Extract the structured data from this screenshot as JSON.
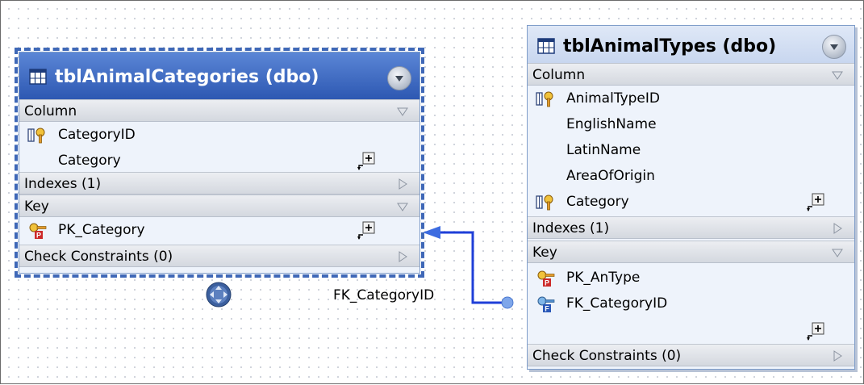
{
  "colors": {
    "selection_accent": "#3f68b7",
    "relation_line": "#1f3fd8",
    "header_selected": "#2d58b2"
  },
  "tables": [
    {
      "title": "tblAnimalCategories (dbo)",
      "icon": "table-icon",
      "selected": true,
      "column_header": "Column",
      "columns": [
        {
          "name": "CategoryID",
          "icon": "key-column-icon"
        },
        {
          "name": "Category",
          "icon": ""
        }
      ],
      "indexes_header": "Indexes (1)",
      "key_header": "Key",
      "keys": [
        {
          "name": "PK_Category",
          "icon": "primary-key-icon"
        }
      ],
      "checks_header": "Check Constraints (0)"
    },
    {
      "title": "tblAnimalTypes (dbo)",
      "icon": "table-icon",
      "selected": false,
      "column_header": "Column",
      "columns": [
        {
          "name": "AnimalTypeID",
          "icon": "key-column-icon"
        },
        {
          "name": "EnglishName",
          "icon": ""
        },
        {
          "name": "LatinName",
          "icon": ""
        },
        {
          "name": "AreaOfOrigin",
          "icon": ""
        },
        {
          "name": "Category",
          "icon": "key-column-icon"
        }
      ],
      "indexes_header": "Indexes (1)",
      "key_header": "Key",
      "keys": [
        {
          "name": "PK_AnType",
          "icon": "primary-key-icon"
        },
        {
          "name": "FK_CategoryID",
          "icon": "foreign-key-icon"
        }
      ],
      "checks_header": "Check Constraints (0)"
    }
  ],
  "relation": {
    "label": "FK_CategoryID"
  }
}
